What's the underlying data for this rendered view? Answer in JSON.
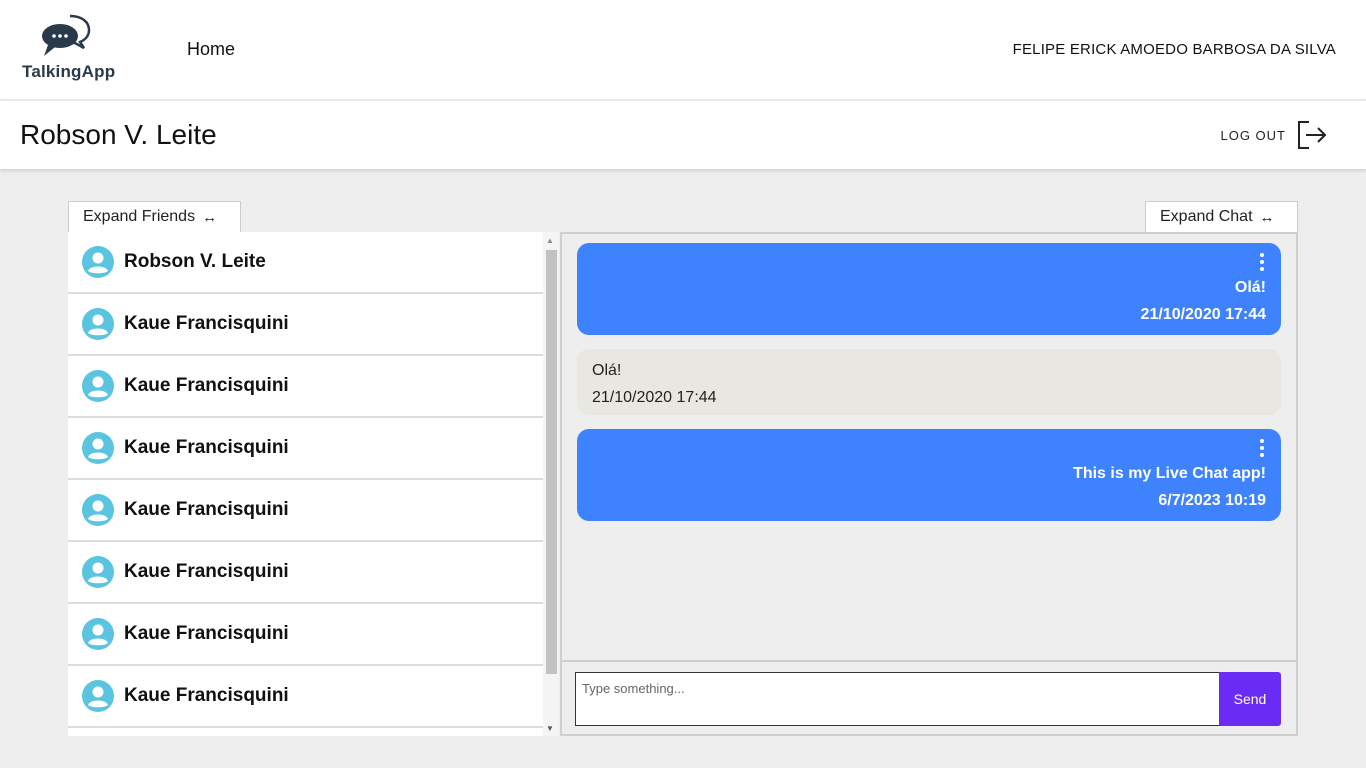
{
  "app": {
    "logo_text": "TalkingApp",
    "logo_icon": "chat-bubbles-icon"
  },
  "nav": {
    "home_label": "Home",
    "user_name": "FELIPE ERICK AMOEDO BARBOSA DA SILVA"
  },
  "header": {
    "title": "Robson V. Leite",
    "logout_label": "LOG OUT",
    "logout_icon": "logout-icon"
  },
  "tabs": {
    "expand_friends": "Expand Friends",
    "expand_chat": "Expand Chat",
    "arrows": "↔"
  },
  "friends": [
    {
      "name": "Robson V. Leite"
    },
    {
      "name": "Kaue Francisquini"
    },
    {
      "name": "Kaue Francisquini"
    },
    {
      "name": "Kaue Francisquini"
    },
    {
      "name": "Kaue Francisquini"
    },
    {
      "name": "Kaue Francisquini"
    },
    {
      "name": "Kaue Francisquini"
    },
    {
      "name": "Kaue Francisquini"
    }
  ],
  "messages": [
    {
      "direction": "out",
      "text": "Olá!",
      "time": "21/10/2020 17:44"
    },
    {
      "direction": "in",
      "text": "Olá!",
      "time": "21/10/2020 17:44"
    },
    {
      "direction": "out",
      "text": "This is my Live Chat app!",
      "time": "6/7/2023 10:19"
    }
  ],
  "composer": {
    "placeholder": "Type something...",
    "value": "",
    "send_label": "Send"
  },
  "colors": {
    "outgoing_bubble": "#3f82fd",
    "incoming_bubble": "#e8e7e1",
    "send_button": "#6a2cf5",
    "avatar": "#5bc4e0"
  }
}
